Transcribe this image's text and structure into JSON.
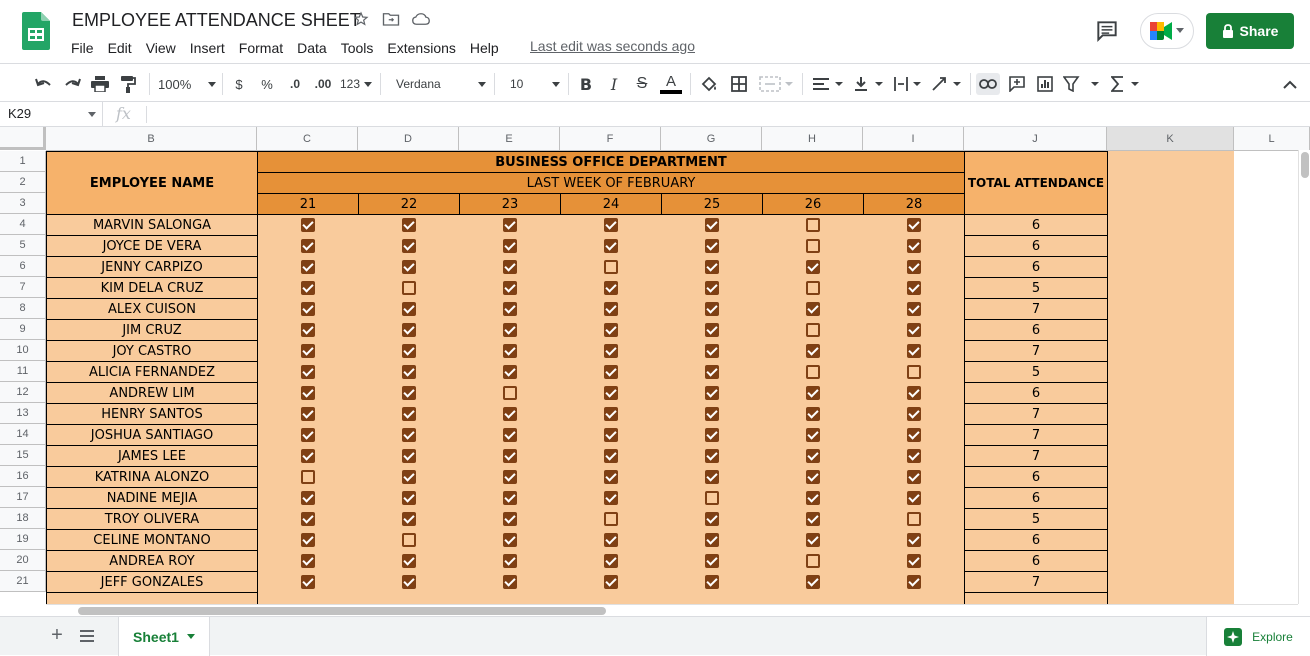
{
  "app": {
    "doc_title": "EMPLOYEE ATTENDANCE SHEET",
    "menu": [
      "File",
      "Edit",
      "View",
      "Insert",
      "Format",
      "Data",
      "Tools",
      "Extensions",
      "Help"
    ],
    "last_edit": "Last edit was seconds ago",
    "share_label": "Share"
  },
  "toolbar": {
    "zoom": "100%",
    "currency": "$",
    "percent": "%",
    "dec_less": ".0",
    "dec_more": ".00",
    "format_more": "123",
    "font": "Verdana",
    "font_size": "10"
  },
  "formula": {
    "cell_ref": "K29",
    "fx": "fx"
  },
  "columns": [
    "B",
    "C",
    "D",
    "E",
    "F",
    "G",
    "H",
    "I",
    "J",
    "K",
    "L"
  ],
  "rows": [
    "1",
    "2",
    "3",
    "4",
    "5",
    "6",
    "7",
    "8",
    "9",
    "10",
    "11",
    "12",
    "13",
    "14",
    "15",
    "16",
    "17",
    "18",
    "19",
    "20",
    "21"
  ],
  "sheet": {
    "employee_header": "EMPLOYEE NAME",
    "department": "BUSINESS OFFICE DEPARTMENT",
    "period": "LAST WEEK OF FEBRUARY",
    "total_header": "TOTAL ATTENDANCE",
    "days": [
      "21",
      "22",
      "23",
      "24",
      "25",
      "26",
      "28"
    ],
    "employees": [
      {
        "name": "MARVIN SALONGA",
        "att": [
          1,
          1,
          1,
          1,
          1,
          0,
          1
        ],
        "total": "6"
      },
      {
        "name": "JOYCE DE VERA",
        "att": [
          1,
          1,
          1,
          1,
          1,
          0,
          1
        ],
        "total": "6"
      },
      {
        "name": "JENNY CARPIZO",
        "att": [
          1,
          1,
          1,
          0,
          1,
          1,
          1
        ],
        "total": "6"
      },
      {
        "name": "KIM DELA CRUZ",
        "att": [
          1,
          0,
          1,
          1,
          1,
          0,
          1
        ],
        "total": "5"
      },
      {
        "name": "ALEX CUISON",
        "att": [
          1,
          1,
          1,
          1,
          1,
          1,
          1
        ],
        "total": "7"
      },
      {
        "name": "JIM CRUZ",
        "att": [
          1,
          1,
          1,
          1,
          1,
          0,
          1
        ],
        "total": "6"
      },
      {
        "name": "JOY CASTRO",
        "att": [
          1,
          1,
          1,
          1,
          1,
          1,
          1
        ],
        "total": "7"
      },
      {
        "name": "ALICIA FERNANDEZ",
        "att": [
          1,
          1,
          1,
          1,
          1,
          0,
          0
        ],
        "total": "5"
      },
      {
        "name": "ANDREW LIM",
        "att": [
          1,
          1,
          0,
          1,
          1,
          1,
          1
        ],
        "total": "6"
      },
      {
        "name": "HENRY SANTOS",
        "att": [
          1,
          1,
          1,
          1,
          1,
          1,
          1
        ],
        "total": "7"
      },
      {
        "name": "JOSHUA SANTIAGO",
        "att": [
          1,
          1,
          1,
          1,
          1,
          1,
          1
        ],
        "total": "7"
      },
      {
        "name": "JAMES LEE",
        "att": [
          1,
          1,
          1,
          1,
          1,
          1,
          1
        ],
        "total": "7"
      },
      {
        "name": "KATRINA ALONZO",
        "att": [
          0,
          1,
          1,
          1,
          1,
          1,
          1
        ],
        "total": "6"
      },
      {
        "name": "NADINE MEJIA",
        "att": [
          1,
          1,
          1,
          1,
          0,
          1,
          1
        ],
        "total": "6"
      },
      {
        "name": "TROY OLIVERA",
        "att": [
          1,
          1,
          1,
          0,
          1,
          1,
          0
        ],
        "total": "5"
      },
      {
        "name": "CELINE MONTANO",
        "att": [
          1,
          0,
          1,
          1,
          1,
          1,
          1
        ],
        "total": "6"
      },
      {
        "name": "ANDREA ROY",
        "att": [
          1,
          1,
          1,
          1,
          1,
          0,
          1
        ],
        "total": "6"
      },
      {
        "name": "JEFF GONZALES",
        "att": [
          1,
          1,
          1,
          1,
          1,
          1,
          1
        ],
        "total": "7"
      }
    ]
  },
  "tabs": {
    "sheet1": "Sheet1",
    "explore": "Explore"
  },
  "colors": {
    "accent_green": "#188038",
    "light_orange": "#f9cb9c",
    "mid_orange": "#f6b26b",
    "dark_orange": "#e69138",
    "check_brown": "#7f4014"
  }
}
